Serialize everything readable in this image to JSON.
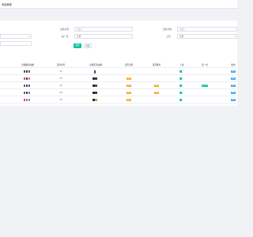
{
  "header": {
    "title": "商品管理"
  },
  "filters": {
    "fields": [
      {
        "label": "道具名称",
        "placeholder": "请输入"
      },
      {
        "label": "道具代码",
        "placeholder": "请输入"
      },
      {
        "label": "是一式",
        "value": "全部"
      },
      {
        "label": "上架",
        "value": "全部"
      }
    ],
    "search_label": "搜索",
    "reset_label": "重置"
  },
  "table": {
    "columns": [
      "详情图滑动图",
      "道具代码",
      "详情页滑动图",
      "是否出售",
      "是否推荐",
      "上架",
      "是一式",
      "操作"
    ],
    "rows": [
      {
        "code": "20",
        "sale": "",
        "recommend": "",
        "enabled": true,
        "is_one": "",
        "action": "编辑"
      },
      {
        "code": "20",
        "sale": "编辑",
        "recommend": "",
        "enabled": true,
        "is_one": "",
        "action": "编辑"
      },
      {
        "code": "20",
        "sale": "编辑",
        "recommend": "编辑",
        "enabled": true,
        "is_one": "是一式",
        "action": "编辑"
      },
      {
        "code": "20",
        "sale": "编辑",
        "recommend": "编辑",
        "enabled": true,
        "is_one": "",
        "action": "编辑"
      },
      {
        "code": "20",
        "sale": "编辑",
        "recommend": "",
        "enabled": true,
        "is_one": "",
        "action": "编辑"
      }
    ]
  },
  "colors": {
    "primary": "#13c29e",
    "warning": "#f5a623",
    "info": "#409eff"
  }
}
